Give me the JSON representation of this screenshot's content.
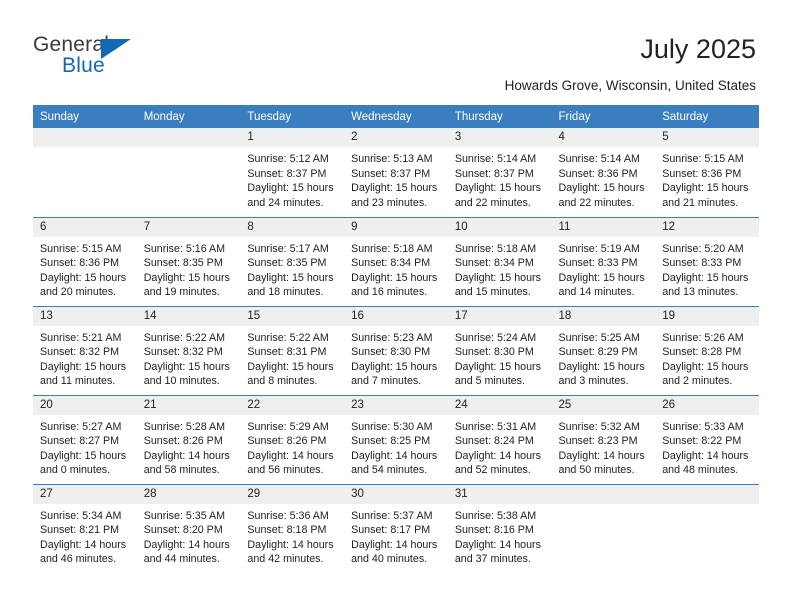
{
  "brand": {
    "name_dark": "General",
    "name_blue": "Blue",
    "accent_color": "#1268b3",
    "header_color": "#3a7ebf"
  },
  "header": {
    "title": "July 2025",
    "subtitle": "Howards Grove, Wisconsin, United States"
  },
  "calendar": {
    "weekday_headers": [
      "Sunday",
      "Monday",
      "Tuesday",
      "Wednesday",
      "Thursday",
      "Friday",
      "Saturday"
    ],
    "weeks": [
      [
        {
          "day": "",
          "sunrise": "",
          "sunset": "",
          "daylight1": "",
          "daylight2": ""
        },
        {
          "day": "",
          "sunrise": "",
          "sunset": "",
          "daylight1": "",
          "daylight2": ""
        },
        {
          "day": "1",
          "sunrise": "Sunrise: 5:12 AM",
          "sunset": "Sunset: 8:37 PM",
          "daylight1": "Daylight: 15 hours",
          "daylight2": "and 24 minutes."
        },
        {
          "day": "2",
          "sunrise": "Sunrise: 5:13 AM",
          "sunset": "Sunset: 8:37 PM",
          "daylight1": "Daylight: 15 hours",
          "daylight2": "and 23 minutes."
        },
        {
          "day": "3",
          "sunrise": "Sunrise: 5:14 AM",
          "sunset": "Sunset: 8:37 PM",
          "daylight1": "Daylight: 15 hours",
          "daylight2": "and 22 minutes."
        },
        {
          "day": "4",
          "sunrise": "Sunrise: 5:14 AM",
          "sunset": "Sunset: 8:36 PM",
          "daylight1": "Daylight: 15 hours",
          "daylight2": "and 22 minutes."
        },
        {
          "day": "5",
          "sunrise": "Sunrise: 5:15 AM",
          "sunset": "Sunset: 8:36 PM",
          "daylight1": "Daylight: 15 hours",
          "daylight2": "and 21 minutes."
        }
      ],
      [
        {
          "day": "6",
          "sunrise": "Sunrise: 5:15 AM",
          "sunset": "Sunset: 8:36 PM",
          "daylight1": "Daylight: 15 hours",
          "daylight2": "and 20 minutes."
        },
        {
          "day": "7",
          "sunrise": "Sunrise: 5:16 AM",
          "sunset": "Sunset: 8:35 PM",
          "daylight1": "Daylight: 15 hours",
          "daylight2": "and 19 minutes."
        },
        {
          "day": "8",
          "sunrise": "Sunrise: 5:17 AM",
          "sunset": "Sunset: 8:35 PM",
          "daylight1": "Daylight: 15 hours",
          "daylight2": "and 18 minutes."
        },
        {
          "day": "9",
          "sunrise": "Sunrise: 5:18 AM",
          "sunset": "Sunset: 8:34 PM",
          "daylight1": "Daylight: 15 hours",
          "daylight2": "and 16 minutes."
        },
        {
          "day": "10",
          "sunrise": "Sunrise: 5:18 AM",
          "sunset": "Sunset: 8:34 PM",
          "daylight1": "Daylight: 15 hours",
          "daylight2": "and 15 minutes."
        },
        {
          "day": "11",
          "sunrise": "Sunrise: 5:19 AM",
          "sunset": "Sunset: 8:33 PM",
          "daylight1": "Daylight: 15 hours",
          "daylight2": "and 14 minutes."
        },
        {
          "day": "12",
          "sunrise": "Sunrise: 5:20 AM",
          "sunset": "Sunset: 8:33 PM",
          "daylight1": "Daylight: 15 hours",
          "daylight2": "and 13 minutes."
        }
      ],
      [
        {
          "day": "13",
          "sunrise": "Sunrise: 5:21 AM",
          "sunset": "Sunset: 8:32 PM",
          "daylight1": "Daylight: 15 hours",
          "daylight2": "and 11 minutes."
        },
        {
          "day": "14",
          "sunrise": "Sunrise: 5:22 AM",
          "sunset": "Sunset: 8:32 PM",
          "daylight1": "Daylight: 15 hours",
          "daylight2": "and 10 minutes."
        },
        {
          "day": "15",
          "sunrise": "Sunrise: 5:22 AM",
          "sunset": "Sunset: 8:31 PM",
          "daylight1": "Daylight: 15 hours",
          "daylight2": "and 8 minutes."
        },
        {
          "day": "16",
          "sunrise": "Sunrise: 5:23 AM",
          "sunset": "Sunset: 8:30 PM",
          "daylight1": "Daylight: 15 hours",
          "daylight2": "and 7 minutes."
        },
        {
          "day": "17",
          "sunrise": "Sunrise: 5:24 AM",
          "sunset": "Sunset: 8:30 PM",
          "daylight1": "Daylight: 15 hours",
          "daylight2": "and 5 minutes."
        },
        {
          "day": "18",
          "sunrise": "Sunrise: 5:25 AM",
          "sunset": "Sunset: 8:29 PM",
          "daylight1": "Daylight: 15 hours",
          "daylight2": "and 3 minutes."
        },
        {
          "day": "19",
          "sunrise": "Sunrise: 5:26 AM",
          "sunset": "Sunset: 8:28 PM",
          "daylight1": "Daylight: 15 hours",
          "daylight2": "and 2 minutes."
        }
      ],
      [
        {
          "day": "20",
          "sunrise": "Sunrise: 5:27 AM",
          "sunset": "Sunset: 8:27 PM",
          "daylight1": "Daylight: 15 hours",
          "daylight2": "and 0 minutes."
        },
        {
          "day": "21",
          "sunrise": "Sunrise: 5:28 AM",
          "sunset": "Sunset: 8:26 PM",
          "daylight1": "Daylight: 14 hours",
          "daylight2": "and 58 minutes."
        },
        {
          "day": "22",
          "sunrise": "Sunrise: 5:29 AM",
          "sunset": "Sunset: 8:26 PM",
          "daylight1": "Daylight: 14 hours",
          "daylight2": "and 56 minutes."
        },
        {
          "day": "23",
          "sunrise": "Sunrise: 5:30 AM",
          "sunset": "Sunset: 8:25 PM",
          "daylight1": "Daylight: 14 hours",
          "daylight2": "and 54 minutes."
        },
        {
          "day": "24",
          "sunrise": "Sunrise: 5:31 AM",
          "sunset": "Sunset: 8:24 PM",
          "daylight1": "Daylight: 14 hours",
          "daylight2": "and 52 minutes."
        },
        {
          "day": "25",
          "sunrise": "Sunrise: 5:32 AM",
          "sunset": "Sunset: 8:23 PM",
          "daylight1": "Daylight: 14 hours",
          "daylight2": "and 50 minutes."
        },
        {
          "day": "26",
          "sunrise": "Sunrise: 5:33 AM",
          "sunset": "Sunset: 8:22 PM",
          "daylight1": "Daylight: 14 hours",
          "daylight2": "and 48 minutes."
        }
      ],
      [
        {
          "day": "27",
          "sunrise": "Sunrise: 5:34 AM",
          "sunset": "Sunset: 8:21 PM",
          "daylight1": "Daylight: 14 hours",
          "daylight2": "and 46 minutes."
        },
        {
          "day": "28",
          "sunrise": "Sunrise: 5:35 AM",
          "sunset": "Sunset: 8:20 PM",
          "daylight1": "Daylight: 14 hours",
          "daylight2": "and 44 minutes."
        },
        {
          "day": "29",
          "sunrise": "Sunrise: 5:36 AM",
          "sunset": "Sunset: 8:18 PM",
          "daylight1": "Daylight: 14 hours",
          "daylight2": "and 42 minutes."
        },
        {
          "day": "30",
          "sunrise": "Sunrise: 5:37 AM",
          "sunset": "Sunset: 8:17 PM",
          "daylight1": "Daylight: 14 hours",
          "daylight2": "and 40 minutes."
        },
        {
          "day": "31",
          "sunrise": "Sunrise: 5:38 AM",
          "sunset": "Sunset: 8:16 PM",
          "daylight1": "Daylight: 14 hours",
          "daylight2": "and 37 minutes."
        },
        {
          "day": "",
          "sunrise": "",
          "sunset": "",
          "daylight1": "",
          "daylight2": ""
        },
        {
          "day": "",
          "sunrise": "",
          "sunset": "",
          "daylight1": "",
          "daylight2": ""
        }
      ]
    ]
  }
}
